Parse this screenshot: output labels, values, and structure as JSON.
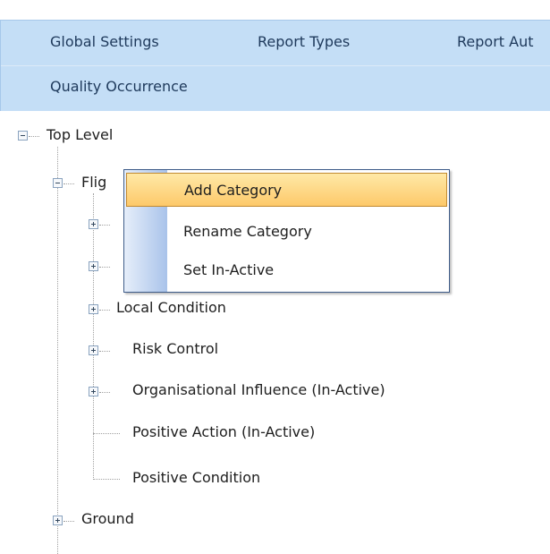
{
  "tabs": [
    {
      "label": "Global Settings"
    },
    {
      "label": "Report Types"
    },
    {
      "label": "Report Aut"
    },
    {
      "label": "Quality Occurrence"
    }
  ],
  "tree": {
    "root": "Top Level",
    "flight": "Flig",
    "local_condition": "Local Condition",
    "risk_control": "Risk Control",
    "organisational_influence": "Organisational Influence (In-Active)",
    "positive_action": "Positive Action (In-Active)",
    "positive_condition": "Positive Condition",
    "ground": "Ground"
  },
  "context_menu": {
    "items": [
      {
        "label": "Add Category"
      },
      {
        "label": "Rename Category"
      },
      {
        "label": "Set In-Active"
      }
    ]
  }
}
